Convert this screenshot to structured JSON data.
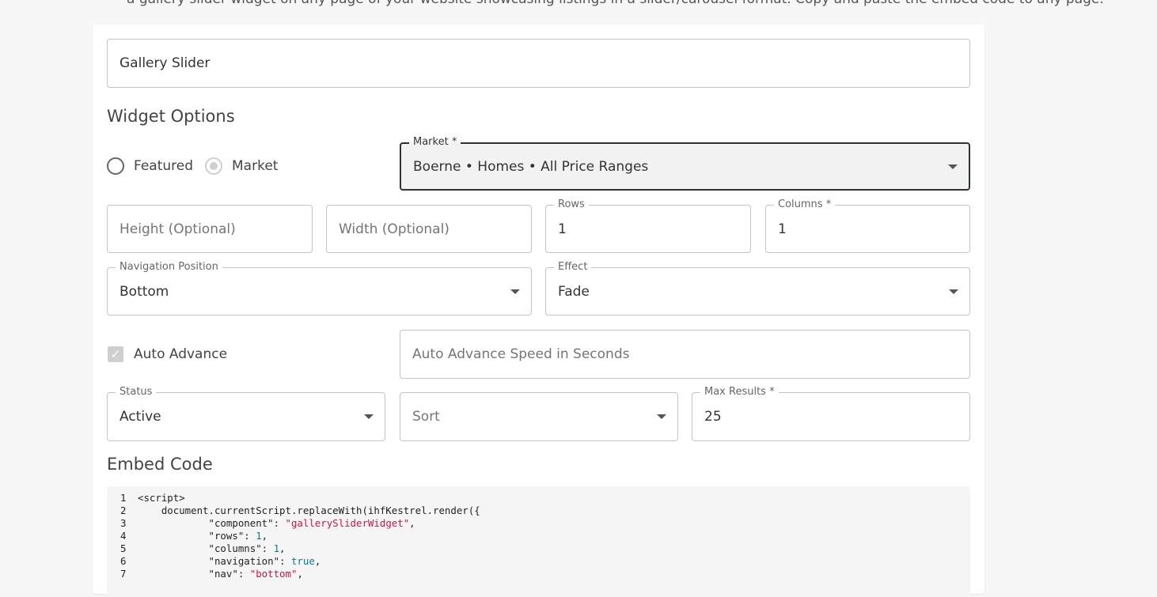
{
  "top_text": "a gallery slider widget on any page of your website showcasing listings in a slider/carousel format. Copy and paste the embed code to any page.",
  "widget_name": {
    "value": "Gallery Slider"
  },
  "widget_options_title": "Widget Options",
  "type_options": [
    {
      "label": "Featured",
      "selected": false
    },
    {
      "label": "Market",
      "selected": true
    }
  ],
  "market": {
    "label": "Market *",
    "value": "Boerne • Homes • All Price Ranges"
  },
  "height": {
    "placeholder": "Height (Optional)"
  },
  "width": {
    "placeholder": "Width (Optional)"
  },
  "rows": {
    "label": "Rows",
    "value": "1"
  },
  "columns": {
    "label": "Columns *",
    "value": "1"
  },
  "navigation_position": {
    "label": "Navigation Position",
    "value": "Bottom"
  },
  "effect": {
    "label": "Effect",
    "value": "Fade"
  },
  "auto_advance": {
    "label": "Auto Advance",
    "checked": true
  },
  "auto_advance_speed": {
    "placeholder": "Auto Advance Speed in Seconds"
  },
  "status": {
    "label": "Status",
    "value": "Active"
  },
  "sort": {
    "placeholder": "Sort"
  },
  "max_results": {
    "label": "Max Results *",
    "value": "25"
  },
  "embed_code_title": "Embed Code",
  "code_lines": [
    {
      "num": "1",
      "parts": [
        [
          "t",
          "<script>"
        ]
      ]
    },
    {
      "num": "2",
      "parts": [
        [
          "t",
          "    document.currentScript.replaceWith(ihfKestrel.render({"
        ]
      ]
    },
    {
      "num": "3",
      "parts": [
        [
          "t",
          "            \"component\": "
        ],
        [
          "s",
          "\"gallerySliderWidget\""
        ],
        [
          "t",
          ","
        ]
      ]
    },
    {
      "num": "4",
      "parts": [
        [
          "t",
          "            \"rows\": "
        ],
        [
          "n",
          "1"
        ],
        [
          "t",
          ","
        ]
      ]
    },
    {
      "num": "5",
      "parts": [
        [
          "t",
          "            \"columns\": "
        ],
        [
          "n",
          "1"
        ],
        [
          "t",
          ","
        ]
      ]
    },
    {
      "num": "6",
      "parts": [
        [
          "t",
          "            \"navigation\": "
        ],
        [
          "n",
          "true"
        ],
        [
          "t",
          ","
        ]
      ]
    },
    {
      "num": "7",
      "parts": [
        [
          "t",
          "            \"nav\": "
        ],
        [
          "s",
          "\"bottom\""
        ],
        [
          "t",
          ","
        ]
      ]
    }
  ],
  "colors": {
    "focused_border": "#2a3338",
    "string": "#c41a3f",
    "number": "#0b7a88"
  }
}
